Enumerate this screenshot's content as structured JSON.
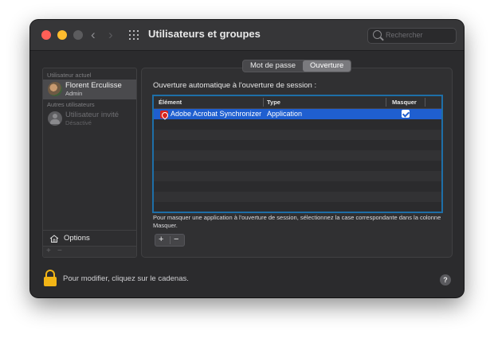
{
  "window": {
    "title": "Utilisateurs et groupes"
  },
  "search": {
    "placeholder": "Rechercher"
  },
  "sidebar": {
    "current_label": "Utilisateur actuel",
    "current_user": {
      "name": "Florent Erculisse",
      "role": "Admin"
    },
    "others_label": "Autres utilisateurs",
    "guest_user": {
      "name": "Utilisateur invité",
      "role": "Désactivé"
    },
    "options_label": "Options",
    "add": "+",
    "remove": "−"
  },
  "tabs": {
    "password": "Mot de passe",
    "login": "Ouverture"
  },
  "main": {
    "heading": "Ouverture automatique à l'ouverture de session :",
    "columns": {
      "item": "Élément",
      "type": "Type",
      "hide": "Masquer"
    },
    "rows": [
      {
        "item": "Adobe Acrobat Synchronizer",
        "type": "Application",
        "hide": true
      }
    ],
    "help": "Pour masquer une application à l'ouverture de session, sélectionnez la case correspondante dans la colonne Masquer.",
    "add": "+",
    "remove": "−"
  },
  "footer": {
    "lock_text": "Pour modifier, cliquez sur le cadenas.",
    "help": "?"
  },
  "colors": {
    "selection": "#1f5fd0",
    "focus_ring": "#1e6fa8",
    "lock": "#f2b516"
  },
  "icons": [
    "back-chevron-icon",
    "forward-chevron-icon",
    "grid-icon",
    "search-icon",
    "user-avatar-icon",
    "guest-avatar-icon",
    "house-icon",
    "pdf-icon",
    "checkbox-icon",
    "lock-icon",
    "help-icon"
  ]
}
